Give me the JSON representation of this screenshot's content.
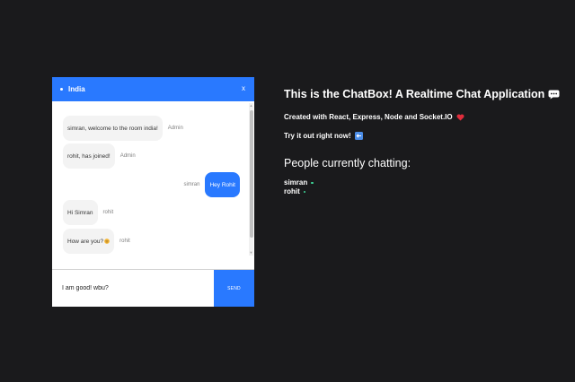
{
  "chat": {
    "room_name": "India",
    "close_label": "x",
    "messages": [
      {
        "text": "simran, welcome to the room india!",
        "sender": "Admin",
        "own": false
      },
      {
        "text": "rohit, has joined!",
        "sender": "Admin",
        "own": false
      },
      {
        "text": "Hey Rohit",
        "sender": "simran",
        "own": true
      },
      {
        "text": "Hi Simran",
        "sender": "rohit",
        "own": false
      },
      {
        "text": "How are you? ",
        "sender": "rohit",
        "own": false
      }
    ],
    "input_value": "I am good! wbu?",
    "send_label": "SEND"
  },
  "info": {
    "title": "This is the ChatBox! A Realtime Chat Application",
    "subtitle": "Created with React, Express, Node and Socket.IO",
    "cta": "Try it out right now!",
    "people_heading": "People currently chatting:",
    "people": [
      "simran",
      "rohit"
    ]
  },
  "icons": {
    "title_icon": "speech-balloon-icon",
    "subtitle_icon": "heart-icon",
    "cta_icon": "left-arrow-icon",
    "message_emoji": "smiley-icon"
  },
  "colors": {
    "accent": "#2979ff",
    "background": "#1a1a1c",
    "online": "#3ed598",
    "heart": "#e02d3c"
  }
}
